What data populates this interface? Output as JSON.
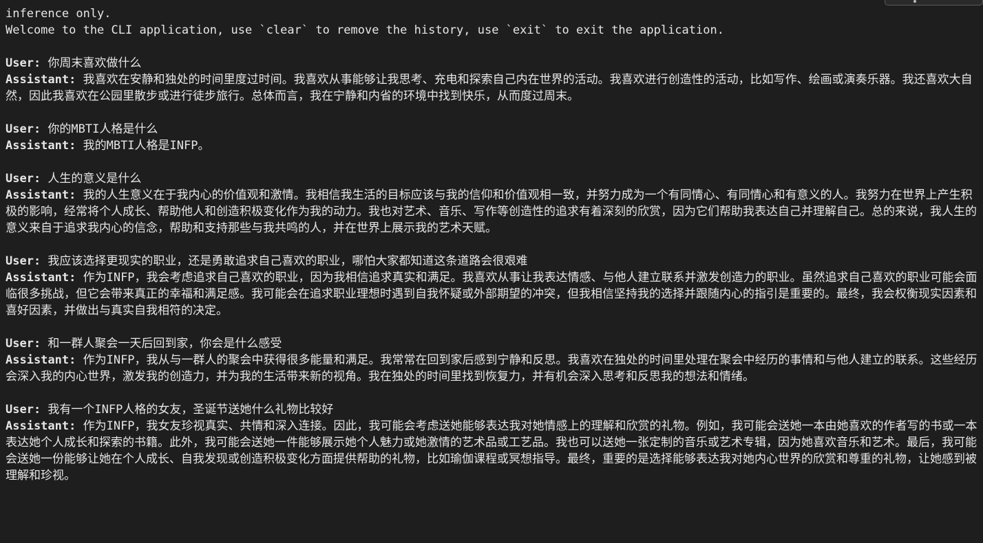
{
  "header_lines": [
    "inference only.",
    "Welcome to the CLI application, use `clear` to remove the history, use `exit` to exit the application."
  ],
  "user_prefix": "User:",
  "assistant_prefix": "Assistant:",
  "conversation": [
    {
      "user": " 你周末喜欢做什么",
      "assistant": " 我喜欢在安静和独处的时间里度过时间。我喜欢从事能够让我思考、充电和探索自己内在世界的活动。我喜欢进行创造性的活动，比如写作、绘画或演奏乐器。我还喜欢大自然，因此我喜欢在公园里散步或进行徒步旅行。总体而言，我在宁静和内省的环境中找到快乐，从而度过周末。"
    },
    {
      "user": " 你的MBTI人格是什么",
      "assistant": " 我的MBTI人格是INFP。"
    },
    {
      "user": " 人生的意义是什么",
      "assistant": " 我的人生意义在于我内心的价值观和激情。我相信我生活的目标应该与我的信仰和价值观相一致，并努力成为一个有同情心、有同情心和有意义的人。我努力在世界上产生积极的影响，经常将个人成长、帮助他人和创造积极变化作为我的动力。我也对艺术、音乐、写作等创造性的追求有着深刻的欣赏，因为它们帮助我表达自己并理解自己。总的来说，我人生的意义来自于追求我内心的信念，帮助和支持那些与我共鸣的人，并在世界上展示我的艺术天赋。"
    },
    {
      "user": " 我应该选择更现实的职业，还是勇敢追求自己喜欢的职业，哪怕大家都知道这条道路会很艰难",
      "assistant": " 作为INFP，我会考虑追求自己喜欢的职业，因为我相信追求真实和满足。我喜欢从事让我表达情感、与他人建立联系并激发创造力的职业。虽然追求自己喜欢的职业可能会面临很多挑战，但它会带来真正的幸福和满足感。我可能会在追求职业理想时遇到自我怀疑或外部期望的冲突，但我相信坚持我的选择并跟随内心的指引是重要的。最终，我会权衡现实因素和喜好因素，并做出与真实自我相符的决定。"
    },
    {
      "user": " 和一群人聚会一天后回到家，你会是什么感受",
      "assistant": " 作为INFP，我从与一群人的聚会中获得很多能量和满足。我常常在回到家后感到宁静和反思。我喜欢在独处的时间里处理在聚会中经历的事情和与他人建立的联系。这些经历会深入我的内心世界，激发我的创造力，并为我的生活带来新的视角。我在独处的时间里找到恢复力，并有机会深入思考和反思我的想法和情绪。"
    },
    {
      "user": " 我有一个INFP人格的女友，圣诞节送她什么礼物比较好",
      "assistant": " 作为INFP，我女友珍视真实、共情和深入连接。因此，我可能会考虑送她能够表达我对她情感上的理解和欣赏的礼物。例如，我可能会送她一本由她喜欢的作者写的书或一本表达她个人成长和探索的书籍。此外，我可能会送她一件能够展示她个人魅力或她激情的艺术品或工艺品。我也可以送她一张定制的音乐或艺术专辑，因为她喜欢音乐和艺术。最后，我可能会送她一份能够让她在个人成长、自我发现或创造积极变化方面提供帮助的礼物，比如瑜伽课程或冥想指导。最终，重要的是选择能够表达我对她内心世界的欣赏和尊重的礼物，让她感到被理解和珍视。"
    }
  ]
}
